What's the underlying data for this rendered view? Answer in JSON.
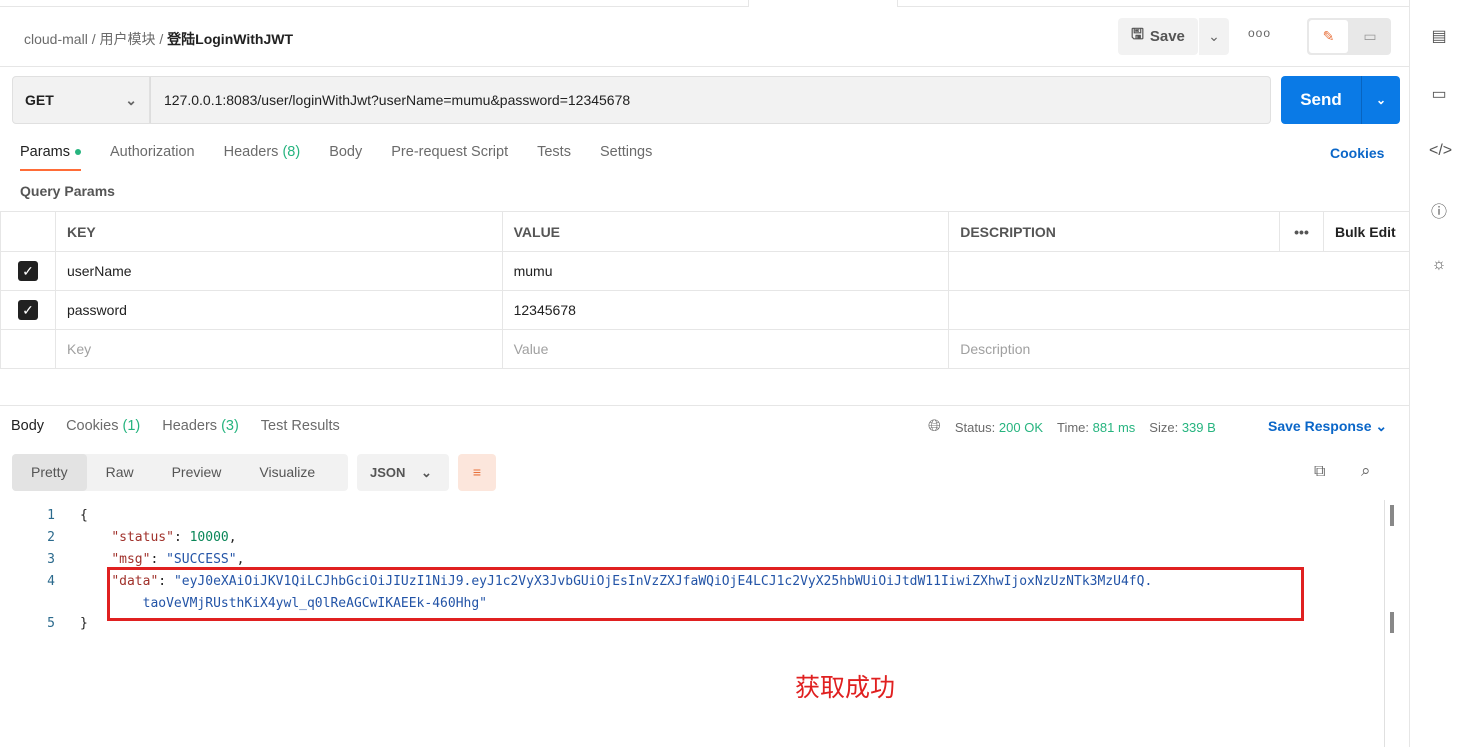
{
  "breadcrumb": {
    "collection": "cloud-mall",
    "folder": "用户模块",
    "request": "登陆LoginWithJWT"
  },
  "header": {
    "save_label": "Save",
    "more_label": "ooo"
  },
  "request": {
    "method": "GET",
    "url": "127.0.0.1:8083/user/loginWithJwt?userName=mumu&password=12345678",
    "send_label": "Send"
  },
  "req_tabs": [
    {
      "label": "Params"
    },
    {
      "label": "Authorization"
    },
    {
      "label": "Headers",
      "count": "(8)"
    },
    {
      "label": "Body"
    },
    {
      "label": "Pre-request Script"
    },
    {
      "label": "Tests"
    },
    {
      "label": "Settings"
    }
  ],
  "cookies_label": "Cookies",
  "query_params": {
    "title": "Query Params",
    "columns": [
      "KEY",
      "VALUE",
      "DESCRIPTION"
    ],
    "bulk_edit": "Bulk Edit",
    "rows": [
      {
        "key": "userName",
        "value": "mumu",
        "description": ""
      },
      {
        "key": "password",
        "value": "12345678",
        "description": ""
      }
    ],
    "placeholder": {
      "key": "Key",
      "value": "Value",
      "description": "Description"
    }
  },
  "response": {
    "tabs": [
      {
        "label": "Body"
      },
      {
        "label": "Cookies",
        "count": "(1)"
      },
      {
        "label": "Headers",
        "count": "(3)"
      },
      {
        "label": "Test Results"
      }
    ],
    "status_label": "Status:",
    "status": "200 OK",
    "time_label": "Time:",
    "time": "881 ms",
    "size_label": "Size:",
    "size": "339 B",
    "save_response": "Save Response",
    "formats": [
      "Pretty",
      "Raw",
      "Preview",
      "Visualize"
    ],
    "language": "JSON",
    "body": {
      "status_key": "\"status\"",
      "status_val": "10000",
      "msg_key": "\"msg\"",
      "msg_val": "\"SUCCESS\"",
      "data_key": "\"data\"",
      "data_val_1": "\"eyJ0eXAiOiJKV1QiLCJhbGciOiJIUzI1NiJ9.eyJ1c2VyX3JvbGUiOjEsInVzZXJfaWQiOjE4LCJ1c2VyX25hbWUiOiJtdW11IiwiZXhwIjoxNzUzNTk3MzU4fQ.",
      "data_val_2": "taoVeVMjRUsthKiX4ywl_q0lReAGCwIKAEEk-460Hhg\""
    }
  },
  "annotation": "获取成功"
}
